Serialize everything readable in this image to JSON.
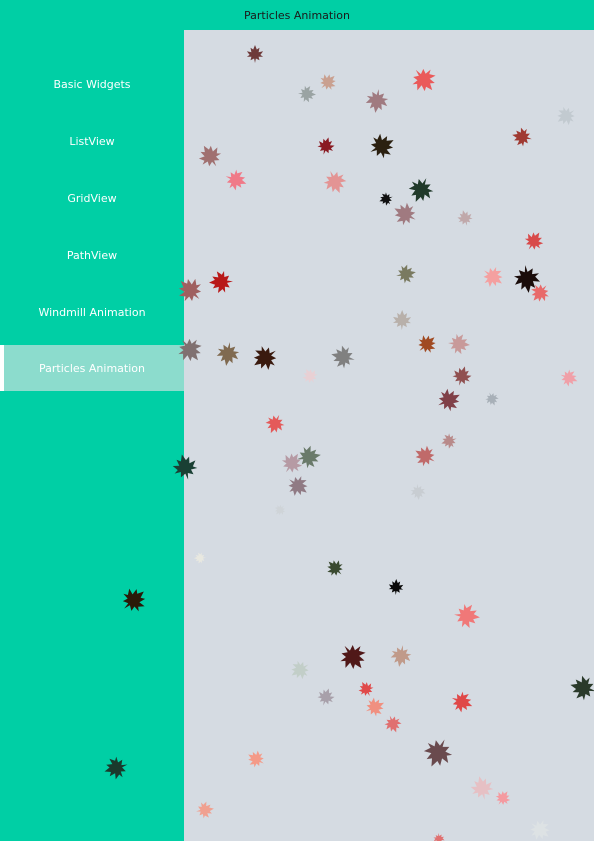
{
  "window": {
    "title": "Particles Animation"
  },
  "sidebar": {
    "items": [
      {
        "label": "Basic Widgets"
      },
      {
        "label": "ListView"
      },
      {
        "label": "GridView"
      },
      {
        "label": "PathView"
      },
      {
        "label": "Windmill Animation"
      },
      {
        "label": "Particles Animation",
        "active": true
      }
    ]
  },
  "scene": {
    "particle_icon": "maple-leaf-icon",
    "colors": {
      "header_bg": "#00cfa5",
      "sidebar_bg": "#00cfa5",
      "active_item_bg": "#8cdccd",
      "content_bg": "#d5dbe2"
    }
  }
}
